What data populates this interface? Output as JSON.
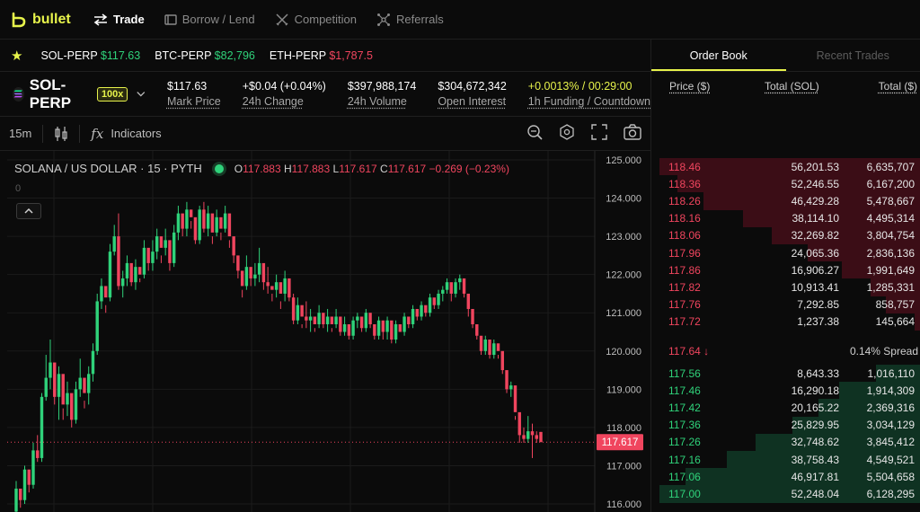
{
  "nav": {
    "brand": "bullet",
    "items": [
      {
        "label": "Trade",
        "icon": "swap-arrows-icon"
      },
      {
        "label": "Borrow / Lend",
        "icon": "bank-icon"
      },
      {
        "label": "Competition",
        "icon": "swords-icon"
      },
      {
        "label": "Referrals",
        "icon": "network-icon"
      }
    ]
  },
  "ticker": [
    {
      "symbol": "SOL-PERP",
      "price": "$117.63",
      "dir": "up"
    },
    {
      "symbol": "BTC-PERP",
      "price": "$82,796",
      "dir": "up"
    },
    {
      "symbol": "ETH-PERP",
      "price": "$1,787.5",
      "dir": "down"
    }
  ],
  "market": {
    "name": "SOL-PERP",
    "leverage": "100x",
    "stats": [
      {
        "value": "$117.63",
        "label": "Mark Price"
      },
      {
        "value": "+$0.04 (+0.04%)",
        "label": "24h Change"
      },
      {
        "value": "$397,988,174",
        "label": "24h Volume"
      },
      {
        "value": "$304,672,342",
        "label": "Open Interest"
      },
      {
        "value": "+0.0013% / 00:29:00",
        "label": "1h Funding / Countdown"
      }
    ]
  },
  "chart_toolbar": {
    "timeframe": "15m",
    "indicators": "Indicators"
  },
  "chart": {
    "legend_title": "SOLANA / US DOLLAR · 15 · PYTH",
    "open_label": "O",
    "open": "117.883",
    "high_label": "H",
    "high": "117.883",
    "low_label": "L",
    "low": "117.617",
    "close_label": "C",
    "close": "117.617",
    "change": "−0.269 (−0.23%)",
    "zero_label": "0",
    "current_price_label": "117.617",
    "colors": {
      "up": "#2fd27a",
      "down": "#f0455e",
      "grid": "#1b1b1b",
      "accent": "#e7f34b"
    }
  },
  "chart_data": {
    "type": "candlestick",
    "title": "SOLANA / US DOLLAR · 15 · PYTH",
    "y_ticks": [
      "125.000",
      "124.000",
      "123.000",
      "122.000",
      "121.000",
      "120.000",
      "119.000",
      "118.000",
      "117.000",
      "116.000"
    ],
    "ylim": [
      116.0,
      125.0
    ],
    "last_price": 117.617,
    "candles": [
      [
        115.8,
        116.6,
        115.7,
        116.4
      ],
      [
        116.4,
        116.2,
        115.9,
        116.1
      ],
      [
        116.1,
        117.0,
        116.0,
        116.9
      ],
      [
        116.9,
        116.6,
        116.3,
        116.5
      ],
      [
        116.5,
        117.6,
        116.4,
        117.4
      ],
      [
        117.4,
        117.8,
        117.1,
        117.2
      ],
      [
        117.2,
        118.9,
        117.1,
        118.8
      ],
      [
        118.8,
        119.9,
        118.7,
        119.3
      ],
      [
        119.3,
        120.3,
        119.0,
        119.7
      ],
      [
        119.7,
        119.0,
        118.6,
        118.8
      ],
      [
        118.8,
        119.6,
        118.2,
        119.4
      ],
      [
        119.4,
        118.5,
        118.2,
        118.6
      ],
      [
        118.6,
        119.2,
        118.3,
        118.9
      ],
      [
        118.9,
        118.4,
        118.0,
        118.2
      ],
      [
        118.2,
        119.2,
        118.1,
        119.0
      ],
      [
        119.0,
        119.8,
        118.8,
        119.3
      ],
      [
        119.3,
        118.7,
        118.5,
        118.9
      ],
      [
        118.9,
        119.6,
        118.6,
        119.4
      ],
      [
        119.4,
        120.2,
        119.2,
        120.0
      ],
      [
        120.0,
        121.5,
        119.9,
        121.3
      ],
      [
        121.3,
        121.9,
        121.1,
        121.7
      ],
      [
        121.7,
        121.2,
        121.0,
        121.4
      ],
      [
        121.4,
        122.8,
        121.3,
        122.6
      ],
      [
        122.6,
        123.3,
        122.5,
        123.0
      ],
      [
        123.0,
        123.6,
        121.6,
        121.7
      ],
      [
        121.7,
        122.1,
        121.4,
        121.9
      ],
      [
        121.9,
        122.5,
        121.7,
        122.3
      ],
      [
        122.3,
        122.0,
        121.7,
        121.8
      ],
      [
        121.8,
        122.4,
        121.6,
        122.2
      ],
      [
        122.2,
        121.9,
        121.8,
        122.0
      ],
      [
        122.0,
        122.9,
        121.9,
        122.7
      ],
      [
        122.7,
        122.4,
        122.1,
        122.3
      ],
      [
        122.3,
        122.9,
        122.1,
        122.6
      ],
      [
        122.6,
        123.2,
        122.4,
        123.0
      ],
      [
        123.0,
        122.5,
        122.3,
        122.7
      ],
      [
        122.7,
        123.2,
        122.5,
        122.9
      ],
      [
        122.9,
        122.4,
        122.1,
        122.3
      ],
      [
        122.3,
        123.3,
        122.2,
        123.1
      ],
      [
        123.1,
        123.8,
        122.9,
        123.6
      ],
      [
        123.6,
        123.3,
        123.0,
        123.2
      ],
      [
        123.2,
        123.9,
        123.0,
        123.7
      ],
      [
        123.7,
        123.4,
        123.2,
        123.5
      ],
      [
        123.5,
        123.1,
        122.8,
        122.9
      ],
      [
        122.9,
        123.8,
        122.8,
        123.7
      ],
      [
        123.7,
        123.9,
        123.1,
        123.2
      ],
      [
        123.2,
        123.8,
        123.0,
        123.6
      ],
      [
        123.6,
        123.0,
        122.8,
        123.1
      ],
      [
        123.1,
        123.7,
        123.0,
        123.5
      ],
      [
        123.5,
        123.1,
        122.9,
        123.2
      ],
      [
        123.2,
        123.8,
        123.1,
        123.6
      ],
      [
        123.6,
        122.9,
        122.7,
        123.0
      ],
      [
        123.0,
        122.6,
        122.3,
        122.5
      ],
      [
        122.5,
        122.3,
        121.9,
        122.1
      ],
      [
        122.1,
        121.6,
        121.4,
        121.7
      ],
      [
        121.7,
        122.5,
        121.6,
        122.2
      ],
      [
        122.2,
        122.0,
        121.7,
        121.9
      ],
      [
        121.9,
        122.3,
        121.7,
        122.0
      ],
      [
        122.0,
        122.7,
        121.8,
        122.3
      ],
      [
        122.3,
        121.9,
        121.6,
        121.8
      ],
      [
        121.8,
        122.2,
        121.5,
        121.7
      ],
      [
        121.7,
        121.5,
        121.3,
        121.6
      ],
      [
        121.6,
        122.0,
        121.4,
        121.8
      ],
      [
        121.8,
        121.3,
        121.1,
        121.5
      ],
      [
        121.5,
        122.1,
        121.3,
        121.9
      ],
      [
        121.9,
        121.6,
        121.3,
        121.4
      ],
      [
        121.4,
        121.5,
        120.7,
        120.8
      ],
      [
        120.8,
        121.4,
        120.7,
        121.2
      ],
      [
        121.2,
        120.7,
        120.6,
        120.9
      ],
      [
        120.9,
        121.3,
        120.6,
        120.8
      ],
      [
        120.8,
        121.1,
        120.5,
        120.9
      ],
      [
        120.9,
        120.6,
        120.5,
        120.7
      ],
      [
        120.7,
        121.2,
        120.6,
        121.0
      ],
      [
        121.0,
        120.8,
        120.6,
        120.7
      ],
      [
        120.7,
        121.1,
        120.5,
        120.9
      ],
      [
        120.9,
        120.6,
        120.5,
        120.7
      ],
      [
        120.7,
        121.1,
        120.6,
        120.9
      ],
      [
        120.9,
        120.6,
        120.4,
        120.5
      ],
      [
        120.5,
        120.9,
        120.4,
        120.7
      ],
      [
        120.7,
        120.5,
        120.3,
        120.4
      ],
      [
        120.4,
        120.9,
        120.3,
        120.8
      ],
      [
        120.8,
        121.0,
        120.6,
        120.9
      ],
      [
        120.9,
        120.7,
        120.5,
        120.6
      ],
      [
        120.6,
        121.1,
        120.5,
        121.0
      ],
      [
        121.0,
        120.9,
        120.6,
        120.7
      ],
      [
        120.7,
        120.5,
        120.3,
        120.4
      ],
      [
        120.4,
        120.9,
        120.3,
        120.8
      ],
      [
        120.8,
        120.6,
        120.3,
        120.5
      ],
      [
        120.5,
        120.9,
        120.3,
        120.8
      ],
      [
        120.8,
        120.5,
        120.2,
        120.3
      ],
      [
        120.3,
        120.8,
        120.2,
        120.7
      ],
      [
        120.7,
        120.6,
        120.5,
        120.5
      ],
      [
        120.5,
        121.0,
        120.4,
        120.9
      ],
      [
        120.9,
        120.8,
        120.6,
        120.7
      ],
      [
        120.7,
        121.2,
        120.6,
        121.1
      ],
      [
        121.1,
        121.0,
        120.8,
        120.9
      ],
      [
        120.9,
        121.3,
        120.8,
        121.2
      ],
      [
        121.2,
        121.1,
        120.9,
        121.0
      ],
      [
        121.0,
        121.5,
        120.9,
        121.4
      ],
      [
        121.4,
        121.3,
        121.1,
        121.2
      ],
      [
        121.2,
        121.6,
        121.1,
        121.5
      ],
      [
        121.5,
        121.7,
        121.3,
        121.6
      ],
      [
        121.6,
        121.9,
        121.5,
        121.8
      ],
      [
        121.8,
        121.5,
        121.3,
        121.5
      ],
      [
        121.5,
        121.9,
        121.4,
        121.8
      ],
      [
        121.8,
        122.0,
        121.6,
        121.9
      ],
      [
        121.9,
        121.6,
        121.4,
        121.5
      ],
      [
        121.5,
        121.2,
        120.9,
        121.1
      ],
      [
        121.1,
        120.8,
        120.6,
        120.7
      ],
      [
        120.7,
        120.5,
        120.3,
        120.4
      ],
      [
        120.4,
        120.1,
        119.9,
        120.0
      ],
      [
        120.0,
        120.4,
        119.9,
        120.3
      ],
      [
        120.3,
        120.0,
        119.8,
        119.9
      ],
      [
        119.9,
        120.3,
        119.8,
        120.2
      ],
      [
        120.2,
        119.9,
        119.8,
        120.0
      ],
      [
        120.0,
        119.6,
        119.4,
        119.5
      ],
      [
        119.5,
        119.1,
        118.9,
        119.0
      ],
      [
        119.0,
        119.2,
        118.8,
        119.1
      ],
      [
        119.1,
        118.3,
        118.2,
        118.4
      ],
      [
        118.4,
        118.0,
        117.6,
        117.8
      ],
      [
        117.8,
        118.0,
        117.6,
        117.7
      ],
      [
        117.7,
        118.3,
        117.6,
        117.9
      ],
      [
        117.9,
        118.1,
        117.2,
        117.8
      ],
      [
        117.8,
        117.9,
        117.6,
        117.7
      ],
      [
        117.883,
        117.883,
        117.617,
        117.617
      ]
    ]
  },
  "orderbook": {
    "tabs": [
      "Order Book",
      "Recent Trades"
    ],
    "headers": [
      "Price ($)",
      "Total (SOL)",
      "Total ($)"
    ],
    "asks": [
      {
        "price": "118.46",
        "size": "56,201.53",
        "total": "6,635,707",
        "depth": 1.0
      },
      {
        "price": "118.36",
        "size": "52,246.55",
        "total": "6,167,200",
        "depth": 0.93
      },
      {
        "price": "118.26",
        "size": "46,429.28",
        "total": "5,478,667",
        "depth": 0.83
      },
      {
        "price": "118.16",
        "size": "38,114.10",
        "total": "4,495,314",
        "depth": 0.68
      },
      {
        "price": "118.06",
        "size": "32,269.82",
        "total": "3,804,754",
        "depth": 0.57
      },
      {
        "price": "117.96",
        "size": "24,065.36",
        "total": "2,836,136",
        "depth": 0.43
      },
      {
        "price": "117.86",
        "size": "16,906.27",
        "total": "1,991,649",
        "depth": 0.3
      },
      {
        "price": "117.82",
        "size": "10,913.41",
        "total": "1,285,331",
        "depth": 0.19
      },
      {
        "price": "117.76",
        "size": "7,292.85",
        "total": "858,757",
        "depth": 0.13
      },
      {
        "price": "117.72",
        "size": "1,237.38",
        "total": "145,664",
        "depth": 0.02
      }
    ],
    "spread_price": "117.64 ↓",
    "spread_pct": "0.14% Spread",
    "bids": [
      {
        "price": "117.56",
        "size": "8,643.33",
        "total": "1,016,110",
        "depth": 0.17
      },
      {
        "price": "117.46",
        "size": "16,290.18",
        "total": "1,914,309",
        "depth": 0.31
      },
      {
        "price": "117.42",
        "size": "20,165.22",
        "total": "2,369,316",
        "depth": 0.39
      },
      {
        "price": "117.36",
        "size": "25,829.95",
        "total": "3,034,129",
        "depth": 0.49
      },
      {
        "price": "117.26",
        "size": "32,748.62",
        "total": "3,845,412",
        "depth": 0.63
      },
      {
        "price": "117.16",
        "size": "38,758.43",
        "total": "4,549,521",
        "depth": 0.74
      },
      {
        "price": "117.06",
        "size": "46,917.81",
        "total": "5,504,658",
        "depth": 0.9
      },
      {
        "price": "117.00",
        "size": "52,248.04",
        "total": "6,128,295",
        "depth": 1.0
      }
    ]
  }
}
